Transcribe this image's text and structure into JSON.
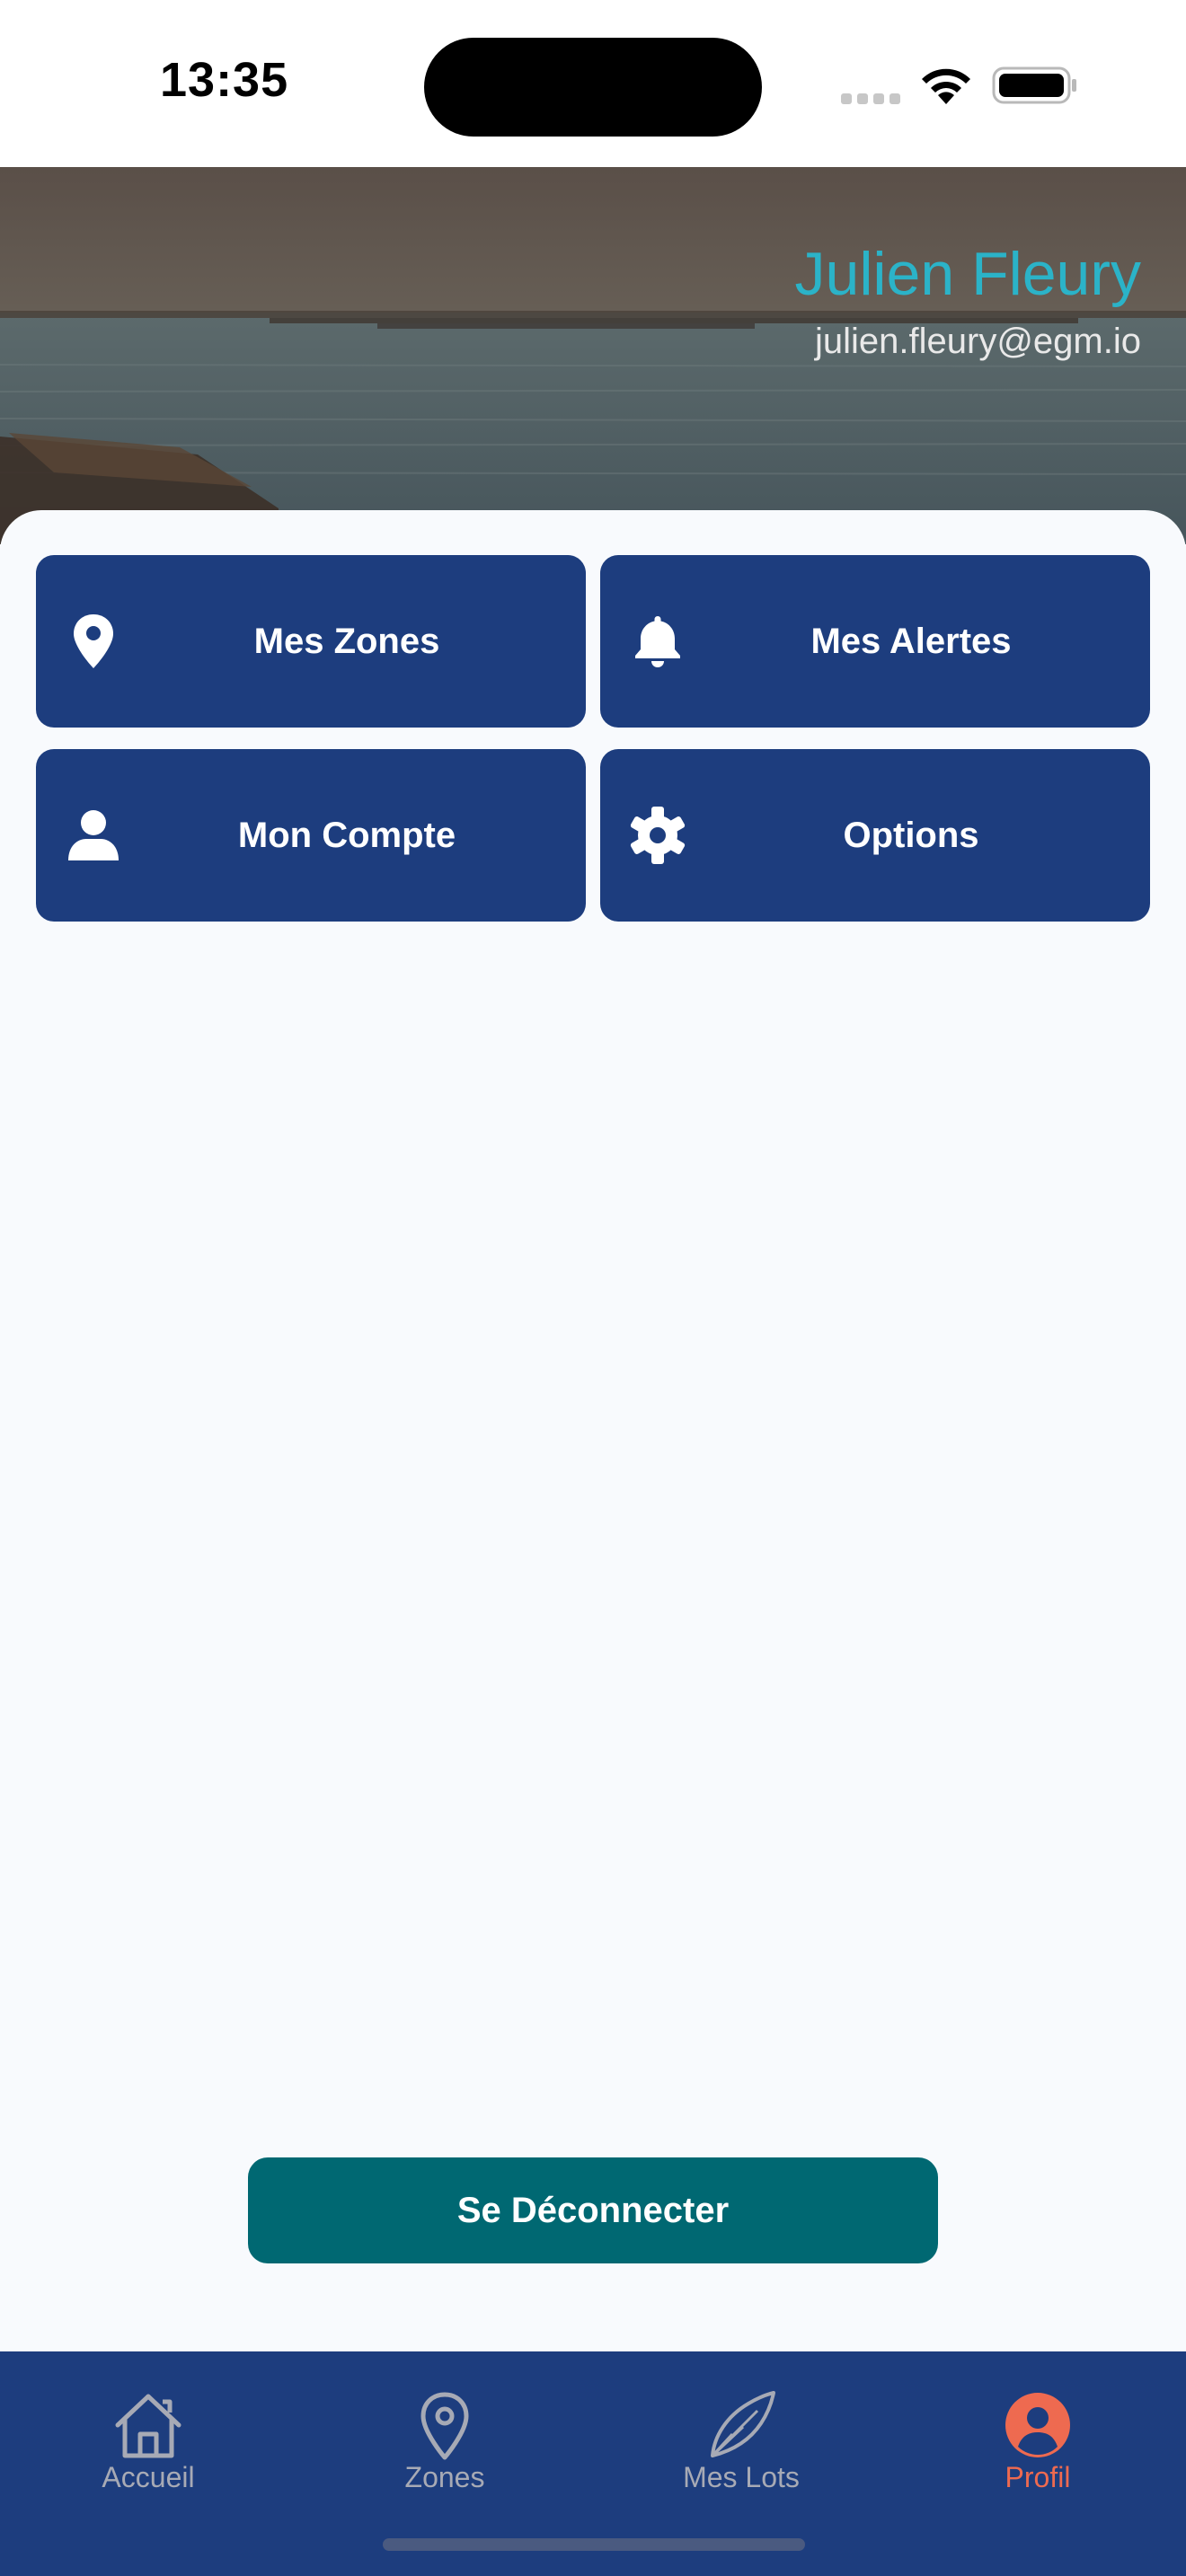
{
  "status_bar": {
    "time": "13:35"
  },
  "profile": {
    "name": "Julien Fleury",
    "email": "julien.fleury@egm.io"
  },
  "menu": {
    "zones_label": "Mes Zones",
    "alertes_label": "Mes Alertes",
    "compte_label": "Mon Compte",
    "options_label": "Options"
  },
  "actions": {
    "logout_label": "Se Déconnecter"
  },
  "tabs": [
    {
      "label": "Accueil",
      "icon": "home-icon",
      "active": false
    },
    {
      "label": "Zones",
      "icon": "map-pin-icon",
      "active": false
    },
    {
      "label": "Mes Lots",
      "icon": "shell-icon",
      "active": false
    },
    {
      "label": "Profil",
      "icon": "user-circle-icon",
      "active": true
    }
  ],
  "colors": {
    "primary": "#1d3d7e",
    "logout": "#006872",
    "name_accent": "#2bb3c8",
    "tab_active": "#ee6a50",
    "tab_inactive": "#a7aab5",
    "background": "#f8fafd"
  }
}
